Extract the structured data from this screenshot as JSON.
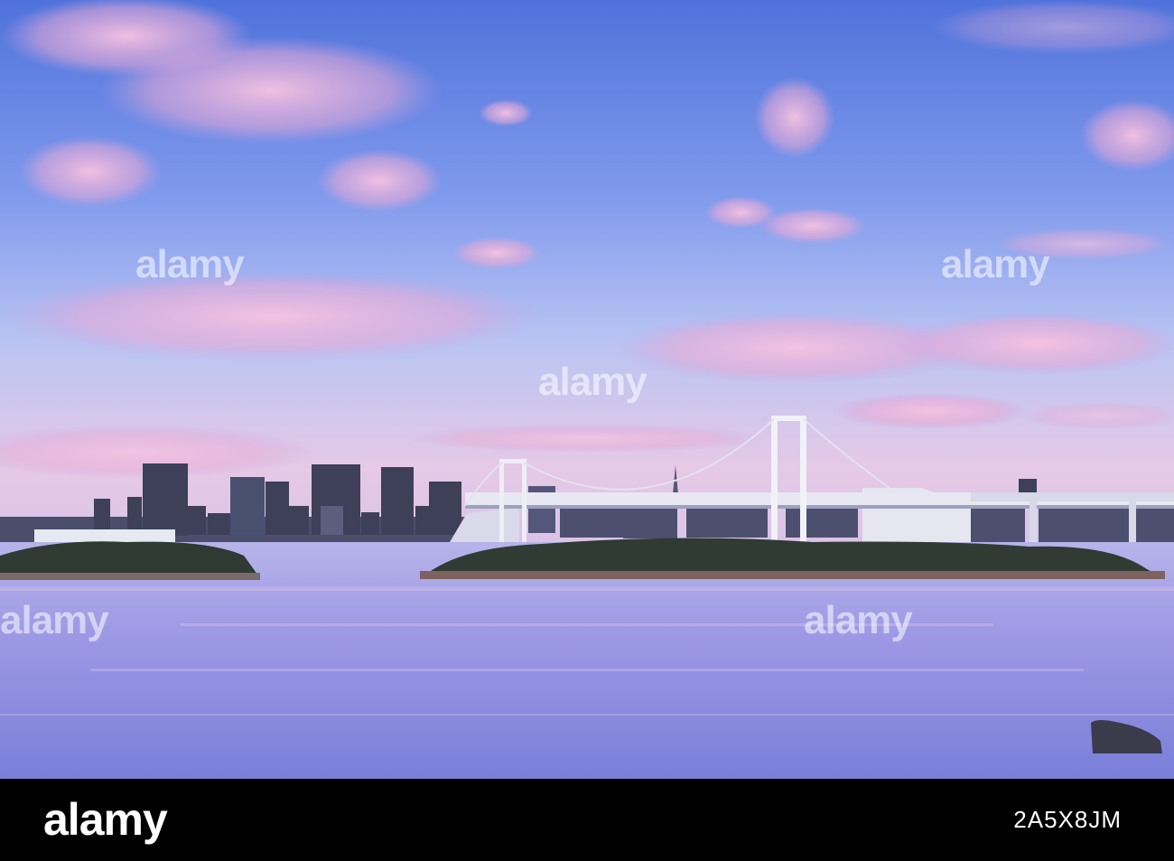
{
  "photo": {
    "subject": "bay-skyline-suspension-bridge-dusk",
    "colors": {
      "sky_top": "#5577dd",
      "sky_mid": "#93a6ef",
      "sky_low": "#e2bfe0",
      "cloud": "#f2b8dc",
      "water": "#8f8ee0",
      "buildings": "#3d4058",
      "bridge": "#e8e8f2"
    }
  },
  "watermarks": {
    "text": "alamy"
  },
  "footer": {
    "logo": "alamy",
    "image_id": "2A5X8JM"
  }
}
